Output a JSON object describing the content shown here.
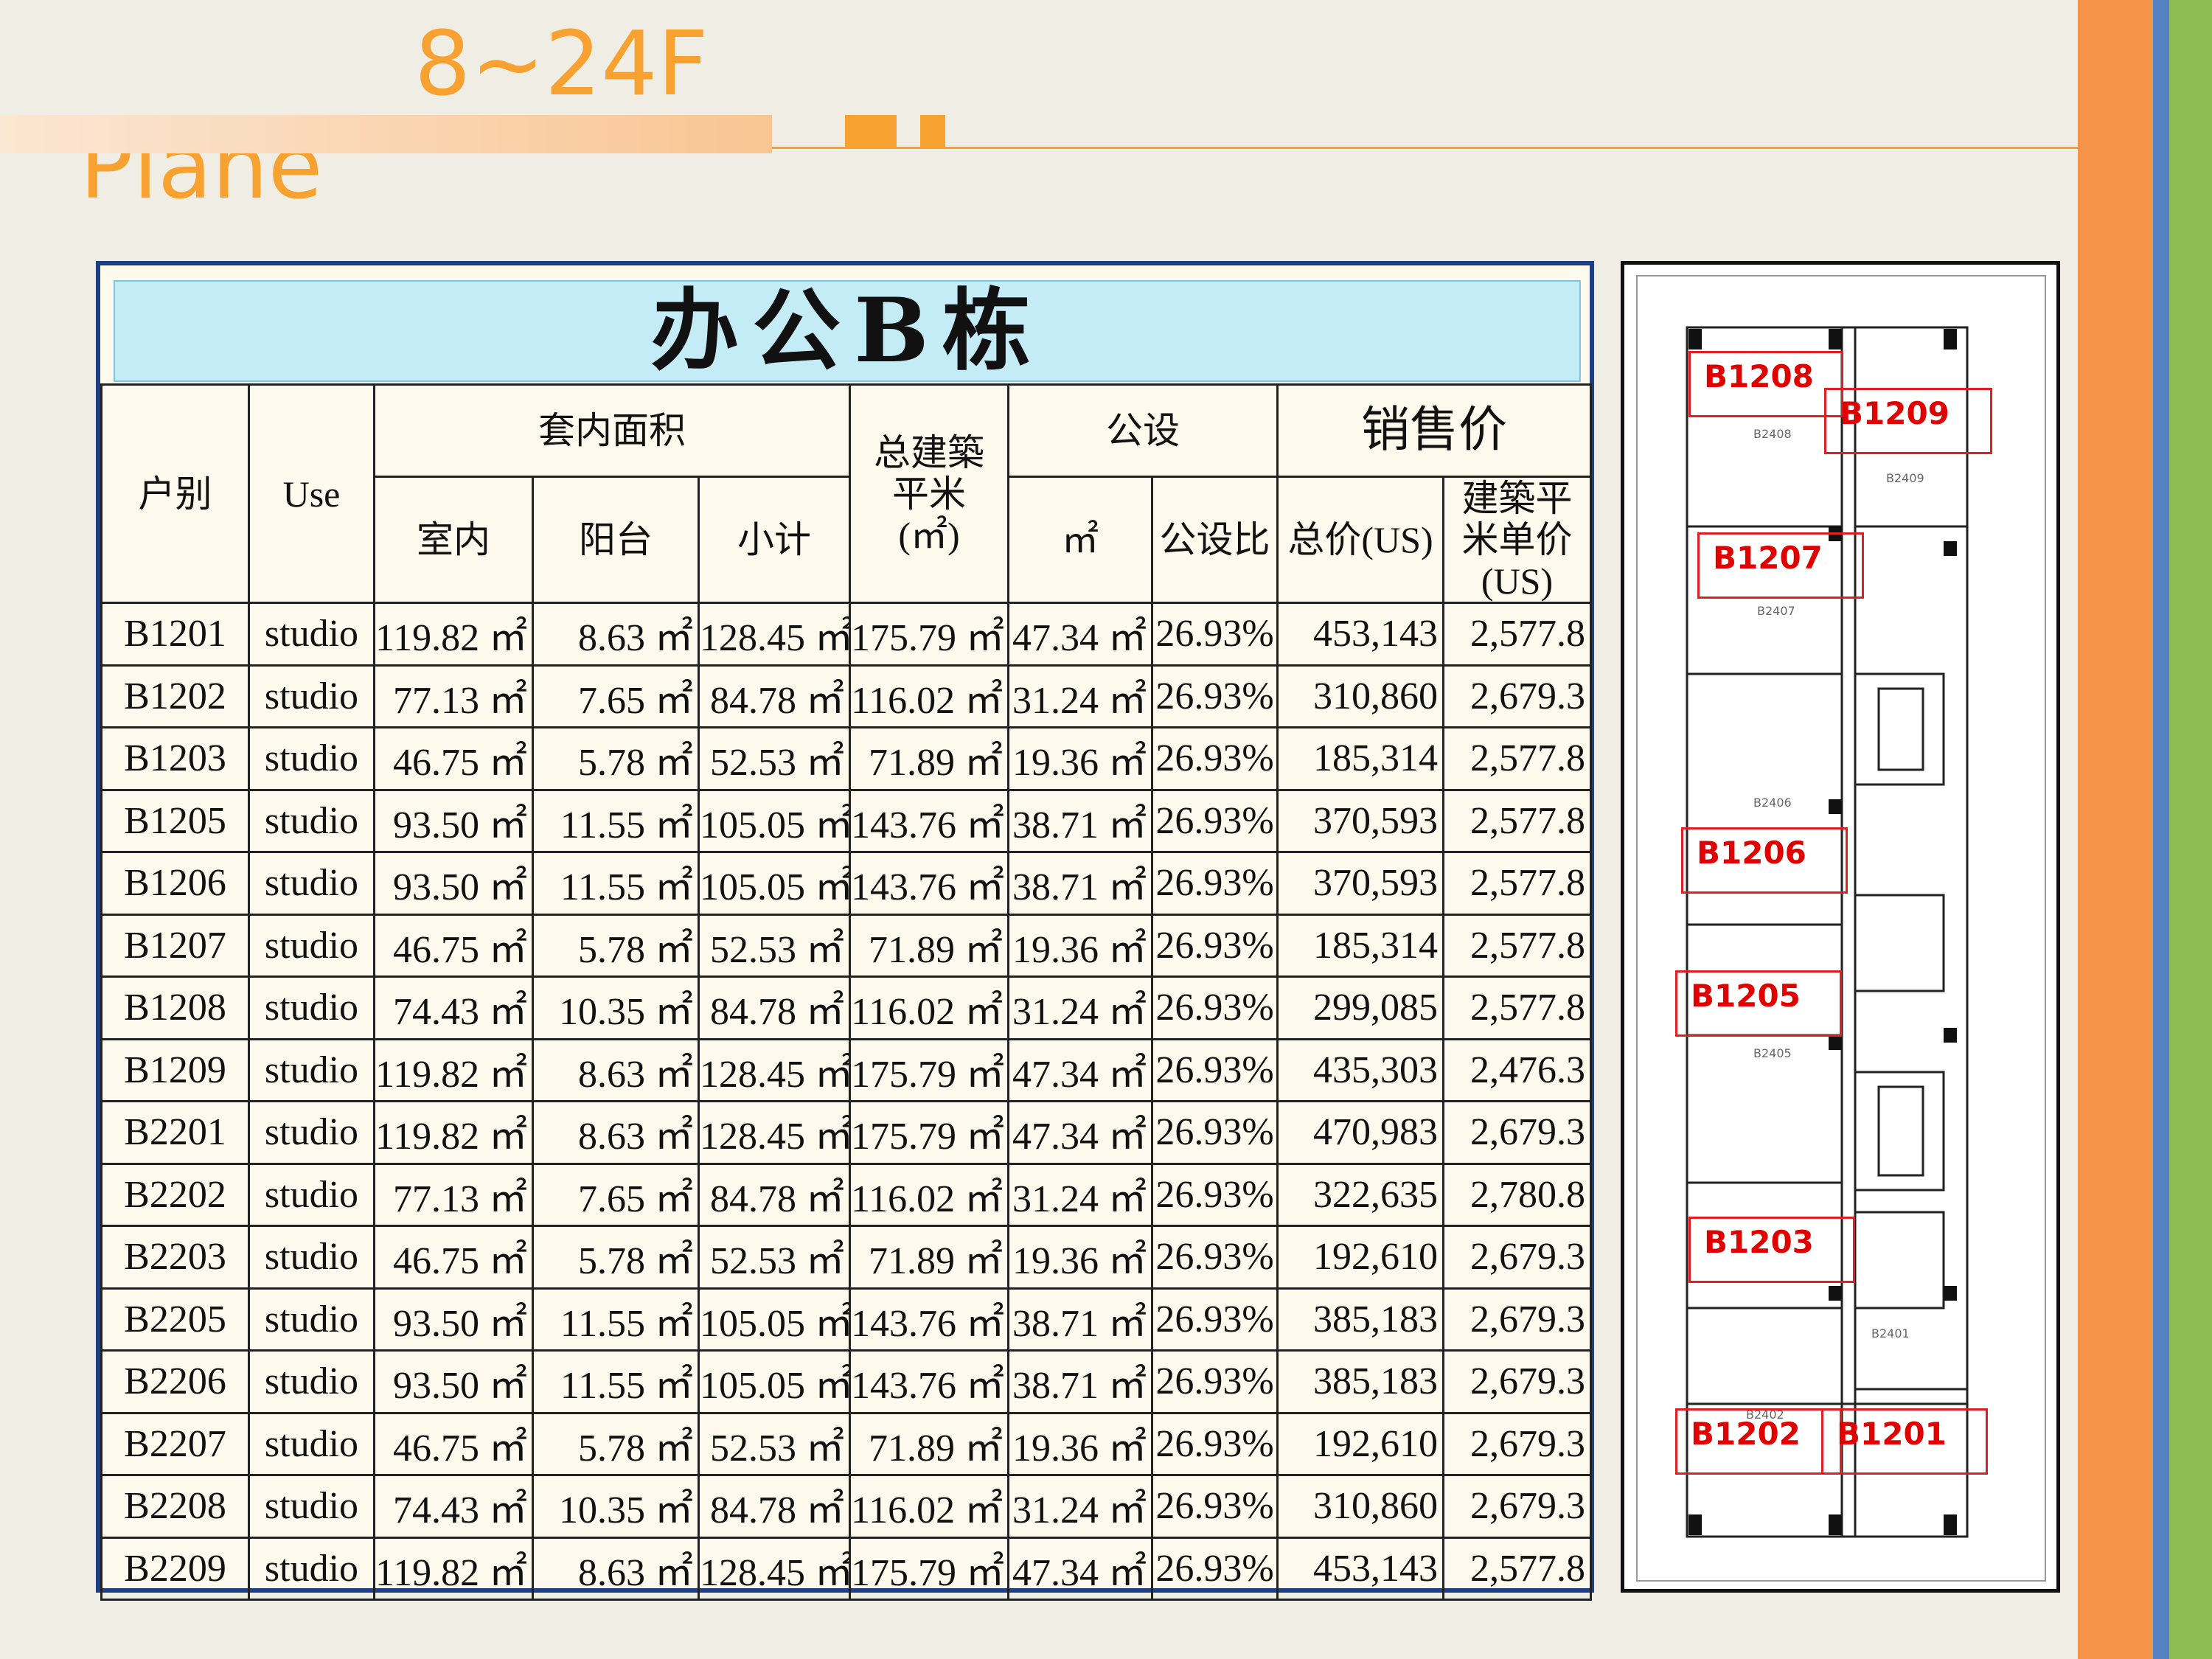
{
  "header": {
    "title": "Plane",
    "floors": "8~24F"
  },
  "table": {
    "title": "办公B栋",
    "headers": {
      "unit": "户别",
      "use": "Use",
      "inner_area": "套内面积",
      "indoor": "室内",
      "balcony": "阳台",
      "subtotal": "小计",
      "gross_area": "总建築平米 (㎡)",
      "common": "公设",
      "common_m2": "㎡",
      "common_ratio": "公设比",
      "sale_price": "销售价",
      "total_price": "总价(US)",
      "unit_price": "建築平米单价(US)"
    },
    "rows": [
      {
        "unit": "B1201",
        "use": "studio",
        "indoor": "119.82 ㎡",
        "balcony": "8.63 ㎡",
        "subtotal": "128.45 ㎡",
        "gross": "175.79 ㎡",
        "common": "47.34 ㎡",
        "ratio": "26.93%",
        "total": "453,143",
        "price": "2,577.8"
      },
      {
        "unit": "B1202",
        "use": "studio",
        "indoor": "77.13 ㎡",
        "balcony": "7.65 ㎡",
        "subtotal": "84.78 ㎡",
        "gross": "116.02 ㎡",
        "common": "31.24 ㎡",
        "ratio": "26.93%",
        "total": "310,860",
        "price": "2,679.3"
      },
      {
        "unit": "B1203",
        "use": "studio",
        "indoor": "46.75 ㎡",
        "balcony": "5.78 ㎡",
        "subtotal": "52.53 ㎡",
        "gross": "71.89 ㎡",
        "common": "19.36 ㎡",
        "ratio": "26.93%",
        "total": "185,314",
        "price": "2,577.8"
      },
      {
        "unit": "B1205",
        "use": "studio",
        "indoor": "93.50 ㎡",
        "balcony": "11.55 ㎡",
        "subtotal": "105.05 ㎡",
        "gross": "143.76 ㎡",
        "common": "38.71 ㎡",
        "ratio": "26.93%",
        "total": "370,593",
        "price": "2,577.8"
      },
      {
        "unit": "B1206",
        "use": "studio",
        "indoor": "93.50 ㎡",
        "balcony": "11.55 ㎡",
        "subtotal": "105.05 ㎡",
        "gross": "143.76 ㎡",
        "common": "38.71 ㎡",
        "ratio": "26.93%",
        "total": "370,593",
        "price": "2,577.8"
      },
      {
        "unit": "B1207",
        "use": "studio",
        "indoor": "46.75 ㎡",
        "balcony": "5.78 ㎡",
        "subtotal": "52.53 ㎡",
        "gross": "71.89 ㎡",
        "common": "19.36 ㎡",
        "ratio": "26.93%",
        "total": "185,314",
        "price": "2,577.8"
      },
      {
        "unit": "B1208",
        "use": "studio",
        "indoor": "74.43 ㎡",
        "balcony": "10.35 ㎡",
        "subtotal": "84.78 ㎡",
        "gross": "116.02 ㎡",
        "common": "31.24 ㎡",
        "ratio": "26.93%",
        "total": "299,085",
        "price": "2,577.8"
      },
      {
        "unit": "B1209",
        "use": "studio",
        "indoor": "119.82 ㎡",
        "balcony": "8.63 ㎡",
        "subtotal": "128.45 ㎡",
        "gross": "175.79 ㎡",
        "common": "47.34 ㎡",
        "ratio": "26.93%",
        "total": "435,303",
        "price": "2,476.3"
      },
      {
        "unit": "B2201",
        "use": "studio",
        "indoor": "119.82 ㎡",
        "balcony": "8.63 ㎡",
        "subtotal": "128.45 ㎡",
        "gross": "175.79 ㎡",
        "common": "47.34 ㎡",
        "ratio": "26.93%",
        "total": "470,983",
        "price": "2,679.3"
      },
      {
        "unit": "B2202",
        "use": "studio",
        "indoor": "77.13 ㎡",
        "balcony": "7.65 ㎡",
        "subtotal": "84.78 ㎡",
        "gross": "116.02 ㎡",
        "common": "31.24 ㎡",
        "ratio": "26.93%",
        "total": "322,635",
        "price": "2,780.8"
      },
      {
        "unit": "B2203",
        "use": "studio",
        "indoor": "46.75 ㎡",
        "balcony": "5.78 ㎡",
        "subtotal": "52.53 ㎡",
        "gross": "71.89 ㎡",
        "common": "19.36 ㎡",
        "ratio": "26.93%",
        "total": "192,610",
        "price": "2,679.3"
      },
      {
        "unit": "B2205",
        "use": "studio",
        "indoor": "93.50 ㎡",
        "balcony": "11.55 ㎡",
        "subtotal": "105.05 ㎡",
        "gross": "143.76 ㎡",
        "common": "38.71 ㎡",
        "ratio": "26.93%",
        "total": "385,183",
        "price": "2,679.3"
      },
      {
        "unit": "B2206",
        "use": "studio",
        "indoor": "93.50 ㎡",
        "balcony": "11.55 ㎡",
        "subtotal": "105.05 ㎡",
        "gross": "143.76 ㎡",
        "common": "38.71 ㎡",
        "ratio": "26.93%",
        "total": "385,183",
        "price": "2,679.3"
      },
      {
        "unit": "B2207",
        "use": "studio",
        "indoor": "46.75 ㎡",
        "balcony": "5.78 ㎡",
        "subtotal": "52.53 ㎡",
        "gross": "71.89 ㎡",
        "common": "19.36 ㎡",
        "ratio": "26.93%",
        "total": "192,610",
        "price": "2,679.3"
      },
      {
        "unit": "B2208",
        "use": "studio",
        "indoor": "74.43 ㎡",
        "balcony": "10.35 ㎡",
        "subtotal": "84.78 ㎡",
        "gross": "116.02 ㎡",
        "common": "31.24 ㎡",
        "ratio": "26.93%",
        "total": "310,860",
        "price": "2,679.3"
      },
      {
        "unit": "B2209",
        "use": "studio",
        "indoor": "119.82 ㎡",
        "balcony": "8.63 ㎡",
        "subtotal": "128.45 ㎡",
        "gross": "175.79 ㎡",
        "common": "47.34 ㎡",
        "ratio": "26.93%",
        "total": "453,143",
        "price": "2,577.8"
      }
    ]
  },
  "plan": {
    "labels": [
      "B1208",
      "B1209",
      "B1207",
      "B1206",
      "B1205",
      "B1203",
      "B1202",
      "B1201"
    ]
  },
  "colors": {
    "accent": "#f7a131",
    "label_red": "#e00000",
    "table_border": "#1c3e86",
    "header_bg": "#c4ecf7"
  }
}
